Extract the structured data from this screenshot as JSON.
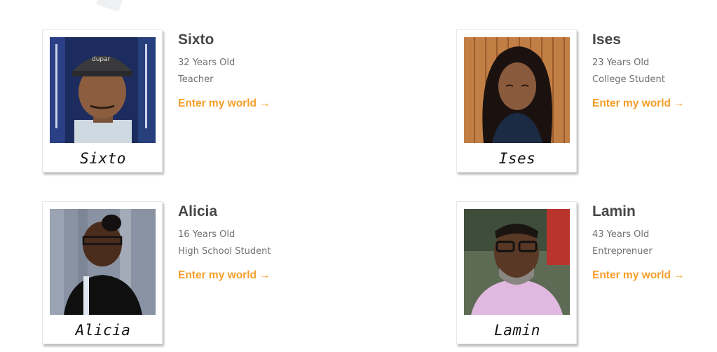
{
  "profiles": [
    {
      "name": "Sixto",
      "caption": "Sixto",
      "age": "32 Years Old",
      "role": "Teacher",
      "link": "Enter my world →"
    },
    {
      "name": "Ises",
      "caption": "Ises",
      "age": "23 Years Old",
      "role": "College Student",
      "link": "Enter my world →"
    },
    {
      "name": "Alicia",
      "caption": "Alicia",
      "age": "16 Years Old",
      "role": "High School Student",
      "link": "Enter my world →"
    },
    {
      "name": "Lamin",
      "caption": "Lamin",
      "age": "43 Years Old",
      "role": "Entreprenuer",
      "link": "Enter my world →"
    }
  ],
  "colors": {
    "accent": "#f59e2a",
    "heading": "#474747",
    "body_text": "#707070"
  }
}
